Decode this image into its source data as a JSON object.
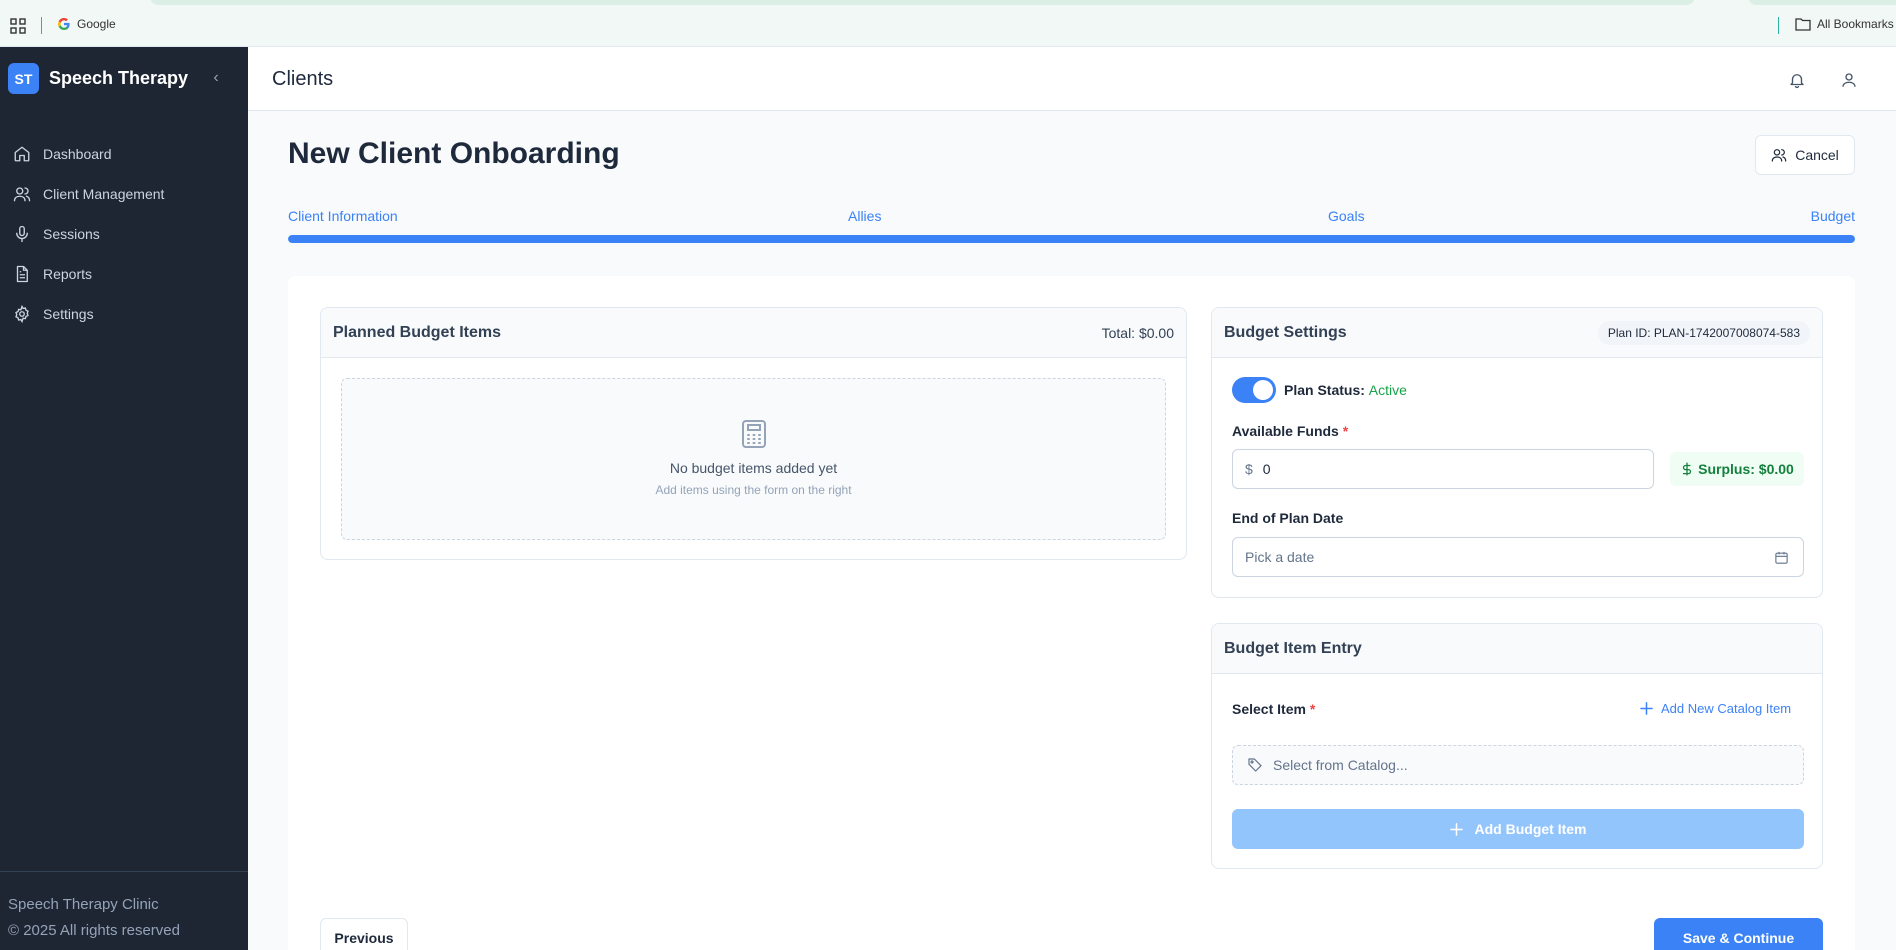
{
  "browser": {
    "bookmark_google": "Google",
    "all_bookmarks": "All Bookmarks"
  },
  "sidebar": {
    "logo": "ST",
    "app_name": "Speech Therapy",
    "items": [
      {
        "label": "Dashboard",
        "icon": "home-icon"
      },
      {
        "label": "Client Management",
        "icon": "users-icon"
      },
      {
        "label": "Sessions",
        "icon": "microphone-icon"
      },
      {
        "label": "Reports",
        "icon": "file-text-icon"
      },
      {
        "label": "Settings",
        "icon": "gear-icon"
      }
    ],
    "footer_line1": "Speech Therapy Clinic",
    "footer_line2": "© 2025 All rights reserved"
  },
  "header": {
    "title": "Clients"
  },
  "page": {
    "title": "New Client Onboarding",
    "cancel_label": "Cancel"
  },
  "steps": {
    "labels": [
      "Client Information",
      "Allies",
      "Goals",
      "Budget"
    ],
    "progress_percent": 100
  },
  "planned": {
    "title": "Planned Budget Items",
    "total": "Total: $0.00",
    "empty_title": "No budget items added yet",
    "empty_sub": "Add items using the form on the right"
  },
  "settings": {
    "title": "Budget Settings",
    "plan_id": "Plan ID: PLAN-1742007008074-583",
    "status_label": "Plan Status:",
    "status_value": "Active",
    "funds_label": "Available Funds",
    "required_mark": "*",
    "currency": "$",
    "funds_value": "0",
    "surplus": "Surplus: $0.00",
    "date_label": "End of Plan Date",
    "date_placeholder": "Pick a date"
  },
  "entry": {
    "title": "Budget Item Entry",
    "select_label": "Select Item",
    "required_mark": "*",
    "add_catalog": "Add New Catalog Item",
    "catalog_placeholder": "Select from Catalog...",
    "add_button": "Add Budget Item"
  },
  "footer": {
    "previous": "Previous",
    "save": "Save & Continue"
  },
  "colors": {
    "accent": "#3b82f6",
    "sidebar_bg": "#1e2533",
    "success": "#16a34a"
  }
}
